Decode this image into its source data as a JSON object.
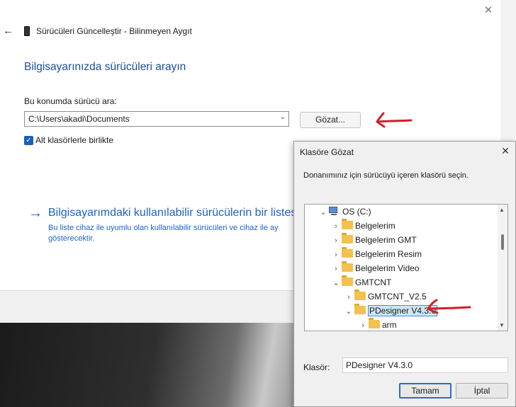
{
  "wizard": {
    "title": "Sürücüleri Güncelleştir - Bilinmeyen Aygıt",
    "heading": "Bilgisayarınızda sürücüleri arayın",
    "search_label": "Bu konumda sürücü ara:",
    "path_value": "C:\\Users\\akadi\\Documents",
    "browse_label": "Gözat...",
    "include_subfolders_label": "Alt klasörlerle birlikte",
    "include_subfolders_checked": true,
    "link_title": "Bilgisayarımdaki kullanılabilir sürücülerin bir listes",
    "link_desc": "Bu liste cihaz ile uyumlu olan kullanılabilir sürücüleri ve cihaz ile ay gösterecektir.",
    "close_glyph": "✕",
    "back_glyph": "←",
    "link_glyph": "→"
  },
  "dialog": {
    "title": "Klasöre Gözat",
    "description": "Donanımınız için sürücüyü içeren klasörü seçin.",
    "tree": [
      {
        "label": "OS (C:)",
        "chev": "⌄",
        "icon": "drive-icon"
      },
      {
        "label": "Belgelerim",
        "chev": "›",
        "icon": "folder-icon"
      },
      {
        "label": "Belgelerim GMT",
        "chev": "›",
        "icon": "folder-icon"
      },
      {
        "label": "Belgelerim Resim",
        "chev": "›",
        "icon": "folder-icon"
      },
      {
        "label": "Belgelerim Video",
        "chev": "›",
        "icon": "folder-icon"
      },
      {
        "label": "GMTCNT",
        "chev": "⌄",
        "icon": "folder-icon"
      },
      {
        "label": "GMTCNT_V2.5",
        "chev": "›",
        "icon": "folder-icon"
      },
      {
        "label": "PDesigner V4.3.0",
        "chev": "⌄",
        "icon": "folder-icon",
        "selected": true
      },
      {
        "label": "arm",
        "chev": "›",
        "icon": "folder-icon"
      }
    ],
    "folder_label": "Klasör:",
    "folder_value": "PDesigner V4.3.0",
    "ok_label": "Tamam",
    "cancel_label": "İptal",
    "close_glyph": "✕"
  },
  "colors": {
    "accent": "#1b63c6",
    "annotation": "#d0202a",
    "selection": "#cce4f7"
  }
}
